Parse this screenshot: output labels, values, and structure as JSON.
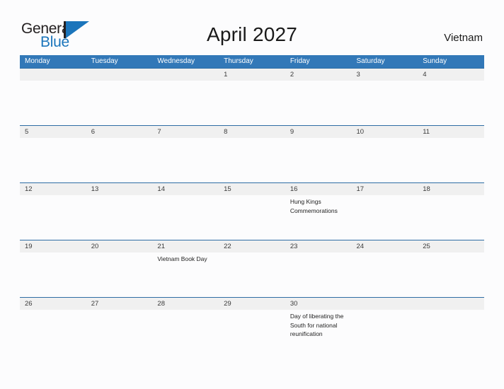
{
  "brand": {
    "name_part1": "General",
    "name_part2": "Blue",
    "mark": "triangle-flag-icon",
    "accent_color": "#1b75bb"
  },
  "header": {
    "title": "April 2027",
    "region": "Vietnam"
  },
  "theme": {
    "header_blue": "#3278b8",
    "rule_blue": "#2e6da4",
    "band_gray": "#f0f0f0",
    "page_background": "#fcfcfd"
  },
  "calendar": {
    "month": "April",
    "year": "2027",
    "weekday_headers": [
      "Monday",
      "Tuesday",
      "Wednesday",
      "Thursday",
      "Friday",
      "Saturday",
      "Sunday"
    ],
    "weeks": [
      {
        "days": [
          {
            "number": "",
            "event": ""
          },
          {
            "number": "",
            "event": ""
          },
          {
            "number": "",
            "event": ""
          },
          {
            "number": "1",
            "event": ""
          },
          {
            "number": "2",
            "event": ""
          },
          {
            "number": "3",
            "event": ""
          },
          {
            "number": "4",
            "event": ""
          }
        ]
      },
      {
        "days": [
          {
            "number": "5",
            "event": ""
          },
          {
            "number": "6",
            "event": ""
          },
          {
            "number": "7",
            "event": ""
          },
          {
            "number": "8",
            "event": ""
          },
          {
            "number": "9",
            "event": ""
          },
          {
            "number": "10",
            "event": ""
          },
          {
            "number": "11",
            "event": ""
          }
        ]
      },
      {
        "days": [
          {
            "number": "12",
            "event": ""
          },
          {
            "number": "13",
            "event": ""
          },
          {
            "number": "14",
            "event": ""
          },
          {
            "number": "15",
            "event": ""
          },
          {
            "number": "16",
            "event": "Hung Kings Commemorations"
          },
          {
            "number": "17",
            "event": ""
          },
          {
            "number": "18",
            "event": ""
          }
        ]
      },
      {
        "days": [
          {
            "number": "19",
            "event": ""
          },
          {
            "number": "20",
            "event": ""
          },
          {
            "number": "21",
            "event": "Vietnam Book Day"
          },
          {
            "number": "22",
            "event": ""
          },
          {
            "number": "23",
            "event": ""
          },
          {
            "number": "24",
            "event": ""
          },
          {
            "number": "25",
            "event": ""
          }
        ]
      },
      {
        "days": [
          {
            "number": "26",
            "event": ""
          },
          {
            "number": "27",
            "event": ""
          },
          {
            "number": "28",
            "event": ""
          },
          {
            "number": "29",
            "event": ""
          },
          {
            "number": "30",
            "event": "Day of liberating the South for national reunification"
          },
          {
            "number": "",
            "event": ""
          },
          {
            "number": "",
            "event": ""
          }
        ]
      }
    ]
  }
}
